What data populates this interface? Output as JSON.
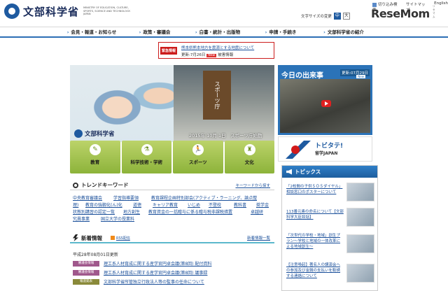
{
  "header": {
    "logo_text": "文部科学省",
    "logo_sub": "MINISTRY OF EDUCATION, CULTURE, SPORTS, SCIENCE AND TECHNOLOGY-JAPAN",
    "util_links": [
      "切り込み検索",
      "サイトマップ",
      "English"
    ],
    "font_size_label": "文字サイズの変更",
    "font_sizes": [
      "中",
      "大"
    ],
    "watermark": "ReseMom",
    "watermark_sub": "リセマム"
  },
  "nav": {
    "items": [
      "会見・報道・お知らせ",
      "政策・審議会",
      "白書・統計・出版物",
      "申請・手続き",
      "文部科学省の紹介"
    ]
  },
  "alert": {
    "tag": "緊急情報",
    "line1": "熊本県熊本地方を震源とする地震について",
    "line2_prefix": "更新:7月26日",
    "line2_badge": "New",
    "line2_suffix": "被害情報"
  },
  "hero": {
    "brand": "文部科学省",
    "caption": "2015年 10月 1日　スポーツ庁始動",
    "sign": "スポーツ庁"
  },
  "tiles": [
    {
      "label": "教育",
      "icon": "pencil-icon",
      "glyph": "✎"
    },
    {
      "label": "科学技術・学術",
      "icon": "flask-icon",
      "glyph": "⚗"
    },
    {
      "label": "スポーツ",
      "icon": "runner-icon",
      "glyph": "🏃"
    },
    {
      "label": "文化",
      "icon": "culture-icon",
      "glyph": "♜"
    }
  ],
  "today": {
    "title": "今日の出来事",
    "date": "更新:07月29日",
    "badge": "New"
  },
  "tobitate": {
    "line1": "トビタテ!",
    "line2": "留学JAPAN"
  },
  "trend": {
    "title": "トレンドキーワード",
    "more": "キーワードから探す",
    "keywords": [
      "中央教育審議会",
      "学習指導要領",
      "教育課程企画特別部会(アクティブ・ラーニング、論点整",
      "理)",
      "教育の強靱化(ん)化",
      "道徳",
      "キャリア教育",
      "いじめ",
      "不登校",
      "教科書",
      "奨学金",
      "状態別講習の認定一覧",
      "地方創生",
      "教育資金の一括贈与に係る贈与税非課税措置",
      "卓越研",
      "究員事業",
      "国立大学の授業料"
    ]
  },
  "news": {
    "title": "新着情報",
    "rss": "RSS配信",
    "more": "新着情報一覧",
    "date": "平成28年08月01日更新",
    "rows": [
      {
        "tag": "審議会情報",
        "tag_color": "#a0588c",
        "text": "理工系人材育成に関する産学官円卓会議(第8回) 配付資料"
      },
      {
        "tag": "審議会情報",
        "tag_color": "#a0588c",
        "text": "理工系人材育成に関する産学官円卓会議(第8回) 議事録"
      },
      {
        "tag": "報道発表",
        "tag_color": "#8a8a3a",
        "text": "文部科学省所管独立行政法人等の監事の任命について"
      }
    ]
  },
  "topics": {
    "title": "トピックス",
    "items": [
      "「2校間の子供ＳＯＳダイヤル」相談窓口のポスターについて",
      "113番元素の命名について【文部科学大臣談話】",
      "「次世代の学校・地域」創生プラン～学校と地域の一体改革による地域創生～",
      "【注意喚起】著名人の講演会への参加及び金銭の支払いを勧誘する連絡について"
    ]
  }
}
